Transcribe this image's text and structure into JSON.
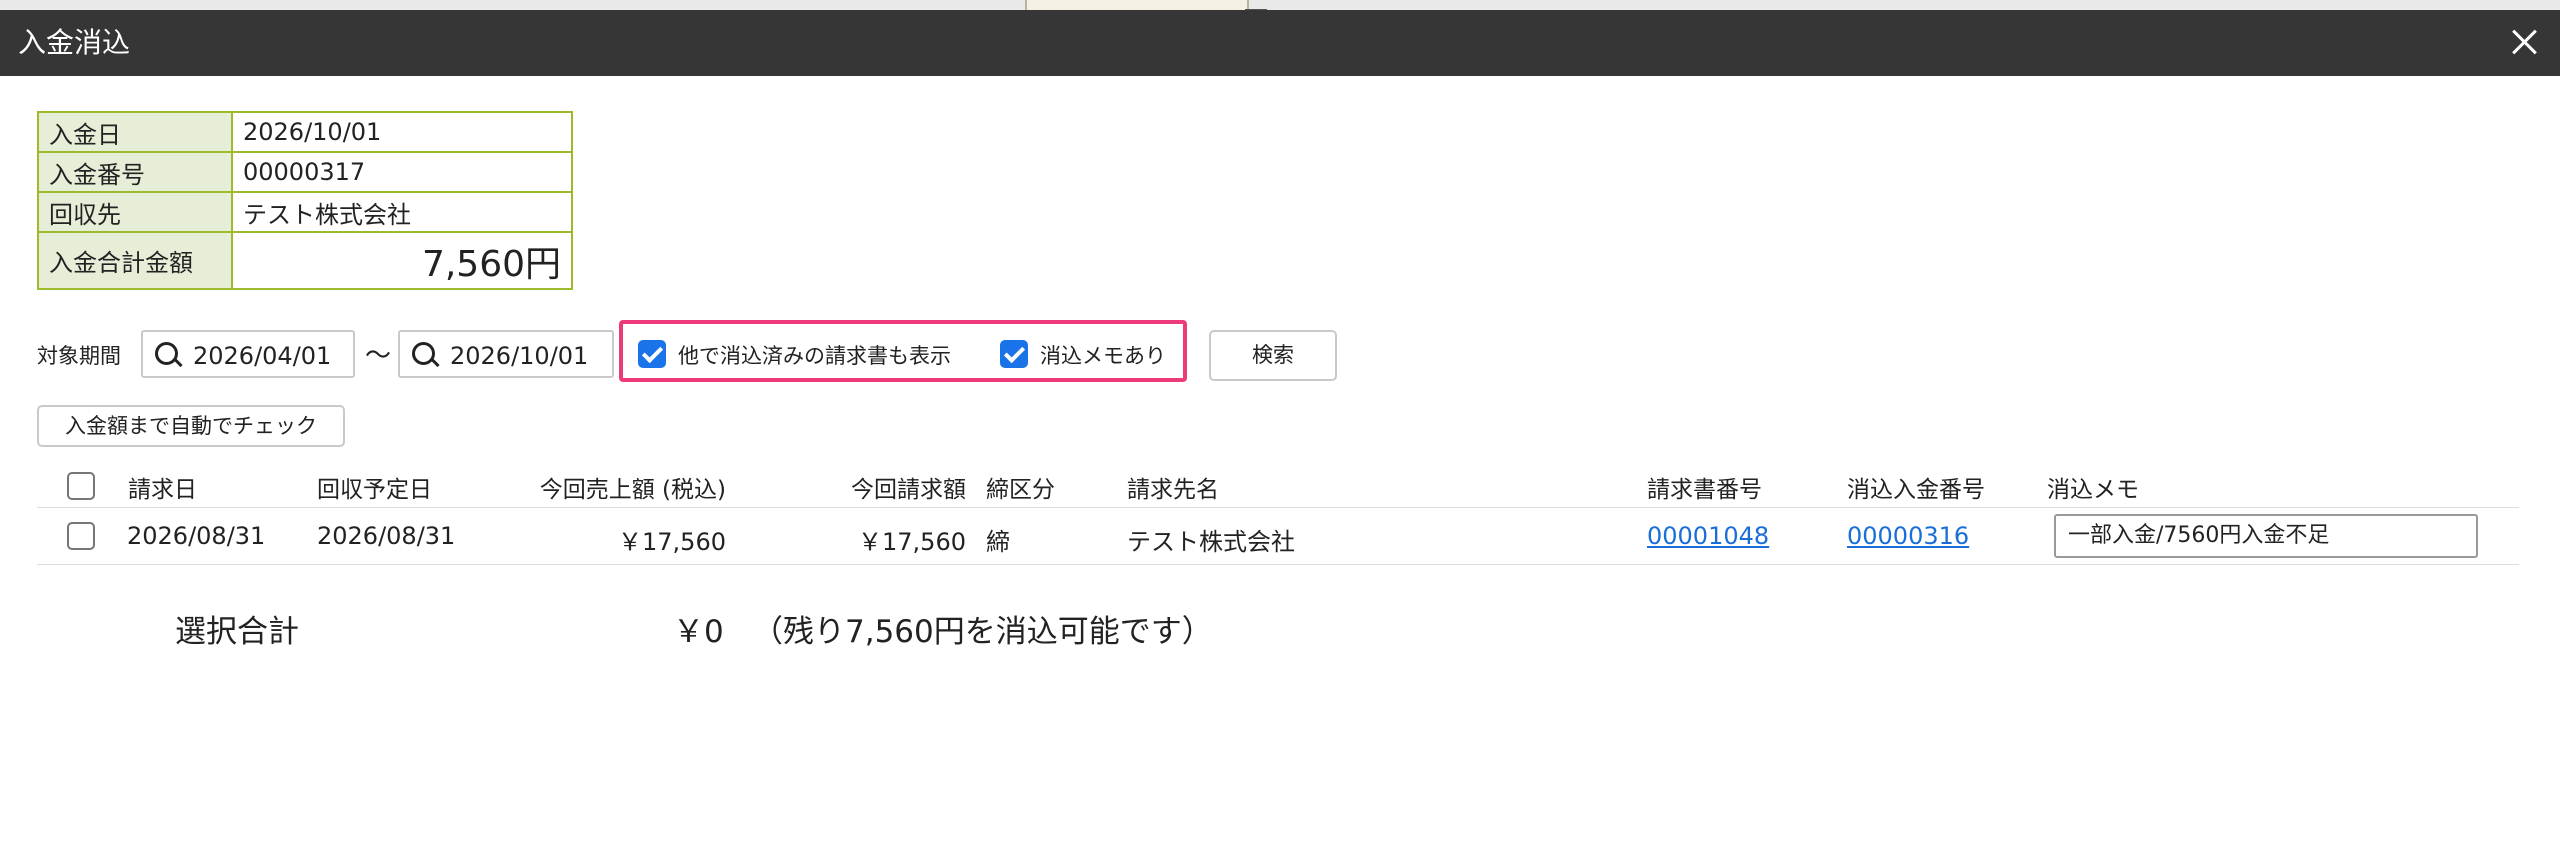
{
  "window": {
    "title": "入金消込"
  },
  "payment": {
    "rows": [
      {
        "label": "入金日",
        "value": "2026/10/01"
      },
      {
        "label": "入金番号",
        "value": "00000317"
      },
      {
        "label": "回収先",
        "value": "テスト株式会社"
      }
    ],
    "total_label": "入金合計金額",
    "total_value": "7,560円"
  },
  "filter": {
    "period_label": "対象期間",
    "date_from": "2026/04/01",
    "separator": "〜",
    "date_to": "2026/10/01",
    "show_cleared_label": "他で消込済みの請求書も表示",
    "show_cleared_checked": true,
    "has_memo_label": "消込メモあり",
    "has_memo_checked": true,
    "search_button": "検索",
    "highlight_color": "#ec3a7b"
  },
  "auto_check_button": "入金額まで自動でチェック",
  "table": {
    "headers": [
      "請求日",
      "回収予定日",
      "今回売上額 (税込)",
      "今回請求額",
      "締区分",
      "請求先名",
      "請求書番号",
      "消込入金番号",
      "消込メモ"
    ],
    "rows": [
      {
        "checked": false,
        "invoice_date": "2026/08/31",
        "due_date": "2026/08/31",
        "sales_amount": "￥17,560",
        "billed_amount": "￥17,560",
        "closing_type": "締",
        "client_name": "テスト株式会社",
        "invoice_no": "00001048",
        "cleared_payment_no": "00000316",
        "memo": "一部入金/7560円入金不足"
      }
    ]
  },
  "summary": {
    "label": "選択合計",
    "value": "￥0",
    "note": "（残り7,560円を消込可能です）"
  },
  "colors": {
    "title_bar": "#363636",
    "link": "#1a6ed8",
    "table_border": "#9bbb2c",
    "checkbox": "#1a73e8"
  }
}
